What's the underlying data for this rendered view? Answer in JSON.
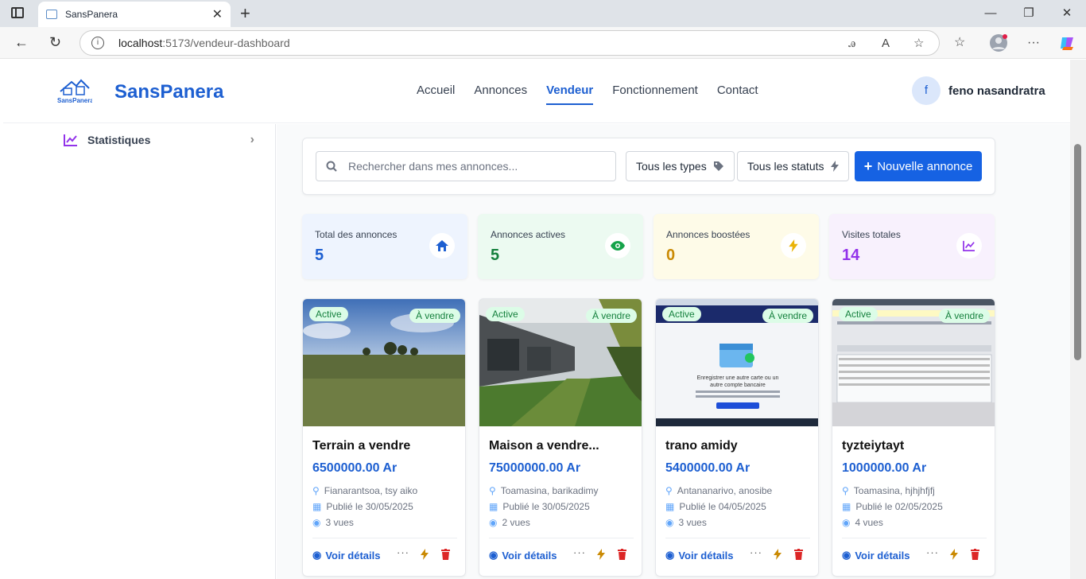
{
  "browser": {
    "tab_title": "SansPanera",
    "url_host": "localhost",
    "url_path": ":5173/vendeur-dashboard"
  },
  "header": {
    "logo_text": "SansPanera",
    "brand": "SansPanera",
    "nav": [
      "Accueil",
      "Annonces",
      "Vendeur",
      "Fonctionnement",
      "Contact"
    ],
    "active_nav": "Vendeur",
    "user_initial": "f",
    "user_name": "feno nasandratra"
  },
  "sidebar": {
    "item_label": "Statistiques"
  },
  "filters": {
    "search_placeholder": "Rechercher dans mes annonces...",
    "types_label": "Tous les types",
    "status_label": "Tous les statuts",
    "new_button": "Nouvelle annonce"
  },
  "stats": [
    {
      "label": "Total des annonces",
      "value": "5",
      "color": "#1d5fd1",
      "bg": "#eef4fe",
      "icon": "home-icon"
    },
    {
      "label": "Annonces actives",
      "value": "5",
      "color": "#15803d",
      "bg": "#ecfaf1",
      "icon": "eye-icon"
    },
    {
      "label": "Annonces boostées",
      "value": "0",
      "color": "#ca8a04",
      "bg": "#fefbe8",
      "icon": "bolt-icon"
    },
    {
      "label": "Visites totales",
      "value": "14",
      "color": "#9333ea",
      "bg": "#f8f1fd",
      "icon": "chart-icon"
    }
  ],
  "listings": [
    {
      "status": "Active",
      "type": "À vendre",
      "title": "Terrain a vendre",
      "price": "6500000.00 Ar",
      "location": "Fianarantsoa, tsy aiko",
      "published": "Publié le 30/05/2025",
      "views": "3 vues",
      "details": "Voir détails"
    },
    {
      "status": "Active",
      "type": "À vendre",
      "title": "Maison a vendre...",
      "price": "75000000.00 Ar",
      "location": "Toamasina, barikadimy",
      "published": "Publié le 30/05/2025",
      "views": "2 vues",
      "details": "Voir détails"
    },
    {
      "status": "Active",
      "type": "À vendre",
      "title": "trano amidy",
      "price": "5400000.00 Ar",
      "location": "Antananarivo, anosibe",
      "published": "Publié le 04/05/2025",
      "views": "3 vues",
      "details": "Voir détails"
    },
    {
      "status": "Active",
      "type": "À vendre",
      "title": "tyzteiytayt",
      "price": "1000000.00 Ar",
      "location": "Toamasina, hjhjhfjfj",
      "published": "Publié le 02/05/2025",
      "views": "4 vues",
      "details": "Voir détails"
    }
  ],
  "screenshot_text": {
    "line1": "Enregistrer une autre carte ou un",
    "line2": "autre compte bancaire"
  },
  "colors": {
    "primary": "#1d5fd1",
    "button": "#1662e3",
    "bolt": "#ca8a04",
    "trash": "#dc2626"
  }
}
